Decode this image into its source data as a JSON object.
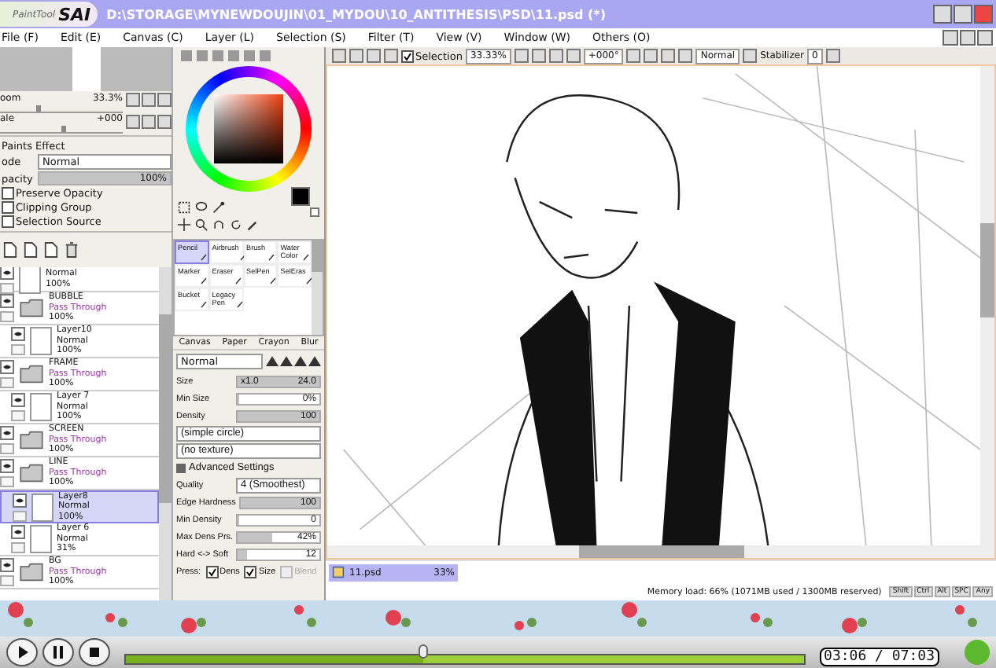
{
  "window": {
    "logo_small": "PaintTool",
    "logo": "SAI",
    "title": "D:\\STORAGE\\MYNEWDOUJIN\\01_MYDOU\\10_ANTITHESIS\\PSD\\11.psd (*)"
  },
  "menu": [
    "File (F)",
    "Edit (E)",
    "Canvas (C)",
    "Layer (L)",
    "Selection (S)",
    "Filter (T)",
    "View (V)",
    "Window (W)",
    "Others (O)"
  ],
  "navigator": {
    "zoom": {
      "label": "oom",
      "value": "33.3%",
      "level": 0.3
    },
    "angle": {
      "label": "ale",
      "value": "+000",
      "level": 0.5
    }
  },
  "layer_props": {
    "section": "Paints Effect",
    "mode_label": "ode",
    "mode": "Normal",
    "opacity": {
      "label": "pacity",
      "value": "100%",
      "level": 1
    },
    "checks": [
      {
        "label": "Preserve Opacity",
        "checked": false
      },
      {
        "label": "Clipping Group",
        "checked": false
      },
      {
        "label": "Selection Source",
        "checked": false
      }
    ]
  },
  "layers": [
    {
      "kind": "layer",
      "mode": "Normal",
      "opacity": "100%",
      "selected": false
    },
    {
      "kind": "folder",
      "name": "BUBBLE",
      "mode": "Pass Through",
      "opacity": "100%",
      "selected": false,
      "children": [
        {
          "kind": "layer",
          "name": "Layer10",
          "mode": "Normal",
          "opacity": "100%",
          "selected": false
        }
      ]
    },
    {
      "kind": "folder",
      "name": "FRAME",
      "mode": "Pass Through",
      "opacity": "100%",
      "selected": false,
      "children": [
        {
          "kind": "layer",
          "name": "Layer 7",
          "mode": "Normal",
          "opacity": "100%",
          "selected": false
        }
      ]
    },
    {
      "kind": "folder",
      "name": "SCREEN",
      "mode": "Pass Through",
      "opacity": "100%",
      "selected": false
    },
    {
      "kind": "folder",
      "name": "LINE",
      "mode": "Pass Through",
      "opacity": "100%",
      "selected": false,
      "children": [
        {
          "kind": "layer",
          "name": "Layer8",
          "mode": "Normal",
          "opacity": "100%",
          "selected": true
        },
        {
          "kind": "layer",
          "name": "Layer 6",
          "mode": "Normal",
          "opacity": "31%",
          "selected": false
        }
      ]
    },
    {
      "kind": "folder",
      "name": "BG",
      "mode": "Pass Through",
      "opacity": "100%",
      "selected": false
    }
  ],
  "tools": [
    {
      "label": "Pencil",
      "selected": true
    },
    {
      "label": "Airbrush",
      "selected": false
    },
    {
      "label": "Brush",
      "selected": false
    },
    {
      "label": "Water Color",
      "selected": false
    },
    {
      "label": "Marker",
      "selected": false
    },
    {
      "label": "Eraser",
      "selected": false
    },
    {
      "label": "SelPen",
      "selected": false
    },
    {
      "label": "SelEras",
      "selected": false
    },
    {
      "label": "Bucket",
      "selected": false
    },
    {
      "label": "Legacy Pen",
      "selected": false
    }
  ],
  "texture_tabs": [
    "Canvas",
    "Paper",
    "Crayon",
    "Blur"
  ],
  "brush": {
    "blend": "Normal",
    "settings": [
      {
        "kind": "slider",
        "label": "Size",
        "prefix": "x1.0",
        "value": "24.0",
        "level": 1
      },
      {
        "kind": "slider",
        "label": "Min Size",
        "value": "0%",
        "level": 0
      },
      {
        "kind": "slider",
        "label": "Density",
        "value": "100",
        "level": 1
      },
      {
        "kind": "dropdown",
        "value": "(simple circle)"
      },
      {
        "kind": "dropdown",
        "value": "(no texture)"
      },
      {
        "kind": "section",
        "label": "Advanced Settings"
      },
      {
        "kind": "dropdown",
        "label": "Quality",
        "value": "4 (Smoothest)"
      },
      {
        "kind": "slider",
        "label": "Edge Hardness",
        "value": "100",
        "level": 1
      },
      {
        "kind": "slider",
        "label": "Min Density",
        "value": "0",
        "level": 0
      },
      {
        "kind": "slider",
        "label": "Max Dens Prs.",
        "value": "42%",
        "level": 0.42
      },
      {
        "kind": "slider",
        "label": "Hard <-> Soft",
        "value": "12",
        "level": 0.12
      },
      {
        "kind": "checks",
        "label": "Press:",
        "items": [
          {
            "label": "Dens",
            "checked": true,
            "disabled": false
          },
          {
            "label": "Size",
            "checked": true,
            "disabled": false
          },
          {
            "label": "Blend",
            "checked": false,
            "disabled": true
          }
        ]
      }
    ]
  },
  "canvas_toolbar": {
    "selection": {
      "label": "Selection",
      "checked": true
    },
    "zoom": "33.33%",
    "angle": "+000°",
    "mode": "Normal",
    "stabilizer_label": "Stabilizer",
    "stabilizer": "0"
  },
  "tabs": [
    {
      "label": "11.psd",
      "zoom": "33%",
      "selected": true
    }
  ],
  "status_bar": {
    "memory": "Memory load: 66% (1071MB used / 1300MB reserved)",
    "keys": [
      "Shift",
      "Ctrl",
      "Alt",
      "SPC",
      "Any"
    ]
  },
  "player": {
    "level": 0.44,
    "time": "03:06 / 07:03"
  }
}
